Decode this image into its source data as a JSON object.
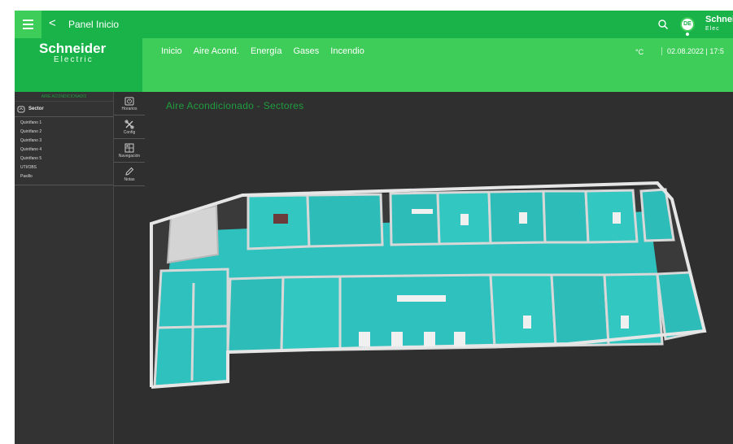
{
  "topbar": {
    "menu_icon": "hamburger-icon",
    "back_icon": "chevron-left-icon",
    "back_label": "<",
    "title": "Panel Inicio",
    "search_icon": "search-icon",
    "avatar_initials": "DE",
    "brand": "Schnei",
    "brand_sub": "Elec"
  },
  "header": {
    "logo_name": "Schneider",
    "logo_sub": "Electric",
    "nav": [
      "Inicio",
      "Aire Acond.",
      "Energía",
      "Gases",
      "Incendio"
    ],
    "unit": "°C",
    "datetime": "02.08.2022 | 17:5"
  },
  "sidebar": {
    "title": "AIRE ACONDICIONADO",
    "sector_label": "Sector",
    "sector_icon": "sector-icon",
    "items": [
      "Quirófano 1",
      "Quirófano 2",
      "Quirófano 3",
      "Quirófano 4",
      "Quirófano 5",
      "UTI/OBS",
      "Pasillo"
    ]
  },
  "tools": [
    {
      "label": "Horarios",
      "icon": "clock-icon"
    },
    {
      "label": "Config",
      "icon": "config-icon"
    },
    {
      "label": "Navegación",
      "icon": "navigation-icon"
    },
    {
      "label": "Notas",
      "icon": "pencil-icon"
    }
  ],
  "main": {
    "title": "Aire Acondicionado - Sectores"
  },
  "colors": {
    "brand_green": "#3dcd58",
    "dark_green": "#19b34a",
    "background": "#2f2f2f",
    "floor": "#2ab7b3"
  }
}
